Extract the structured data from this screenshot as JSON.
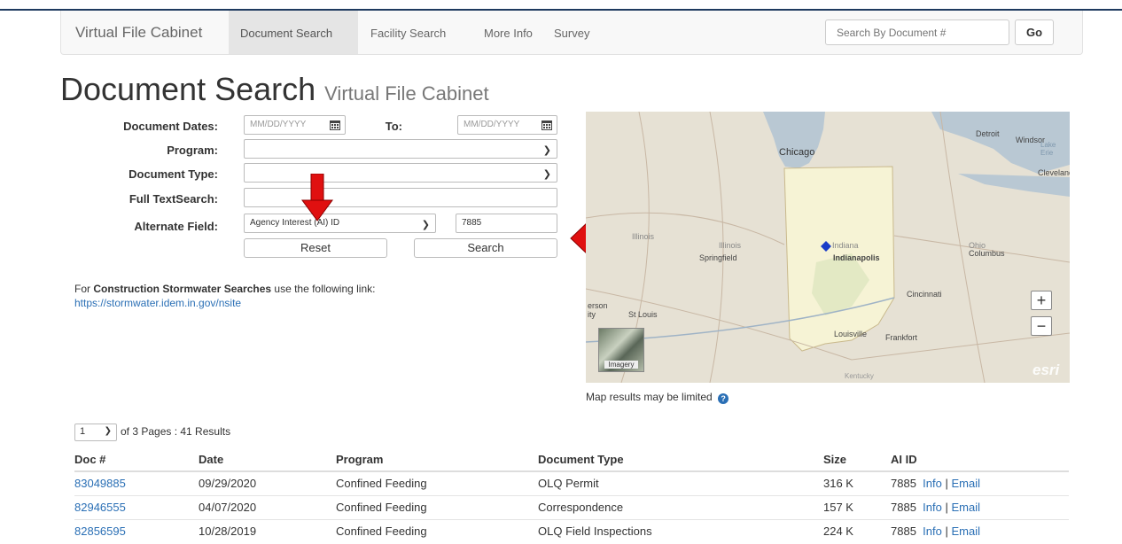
{
  "navbar": {
    "brand": "Virtual File Cabinet",
    "links": [
      "Document Search",
      "Facility Search",
      "More Info",
      "Survey"
    ],
    "search_placeholder": "Search By Document #",
    "go_label": "Go"
  },
  "page": {
    "title": "Document Search",
    "subtitle": "Virtual File Cabinet"
  },
  "form": {
    "dates_label": "Document Dates:",
    "date_from_placeholder": "MM/DD/YYYY",
    "to_label": "To:",
    "date_to_placeholder": "MM/DD/YYYY",
    "program_label": "Program:",
    "program_value": "",
    "doctype_label": "Document Type:",
    "doctype_value": "",
    "fulltext_label": "Full TextSearch:",
    "fulltext_value": "",
    "alt_label": "Alternate Field:",
    "alt_select_value": "Agency Interest (AI) ID",
    "alt_value": "7885",
    "reset_label": "Reset",
    "search_label": "Search"
  },
  "stormwater": {
    "prefix": "For ",
    "bold": "Construction Stormwater Searches",
    "suffix": " use the following link:",
    "link": "https://stormwater.idem.in.gov/nsite"
  },
  "map": {
    "labels": {
      "chicago": "Chicago",
      "detroit": "Detroit",
      "windsor": "Windsor",
      "lake_erie": "Lake Erie",
      "cleveland": "Clevelanc",
      "illinois": "Illinois",
      "illinois2": "Illinois",
      "springfield": "Springfield",
      "indiana": "Indiana",
      "indianapolis": "Indianapolis",
      "ohio": "Ohio",
      "columbus": "Columbus",
      "cincinnati": "Cincinnati",
      "st_louis": "St Louis",
      "jefferson": "erson",
      "city": "ity",
      "louisville": "Louisville",
      "frankfort": "Frankfort",
      "kentucky": "Kentucky",
      "imagery": "Imagery",
      "esri": "esri"
    },
    "zoom_in": "+",
    "zoom_out": "−",
    "note": "Map results may be limited"
  },
  "pager": {
    "page": "1",
    "summary": "of 3 Pages : 41 Results"
  },
  "table": {
    "headers": [
      "Doc #",
      "Date",
      "Program",
      "Document Type",
      "Size",
      "AI ID"
    ],
    "rows": [
      {
        "doc": "83049885",
        "date": "09/29/2020",
        "program": "Confined Feeding",
        "type": "OLQ Permit",
        "size": "316 K",
        "ai": "7885",
        "info": "Info",
        "sep": "|",
        "email": "Email"
      },
      {
        "doc": "82946555",
        "date": "04/07/2020",
        "program": "Confined Feeding",
        "type": "Correspondence",
        "size": "157 K",
        "ai": "7885",
        "info": "Info",
        "sep": "|",
        "email": "Email"
      },
      {
        "doc": "82856595",
        "date": "10/28/2019",
        "program": "Confined Feeding",
        "type": "OLQ Field Inspections",
        "size": "224 K",
        "ai": "7885",
        "info": "Info",
        "sep": "|",
        "email": "Email"
      }
    ]
  },
  "colors": {
    "link": "#2a6fb5",
    "arrow": "#e01010",
    "marker": "#1a3cc8",
    "indiana_fill": "#f6f3d5"
  }
}
